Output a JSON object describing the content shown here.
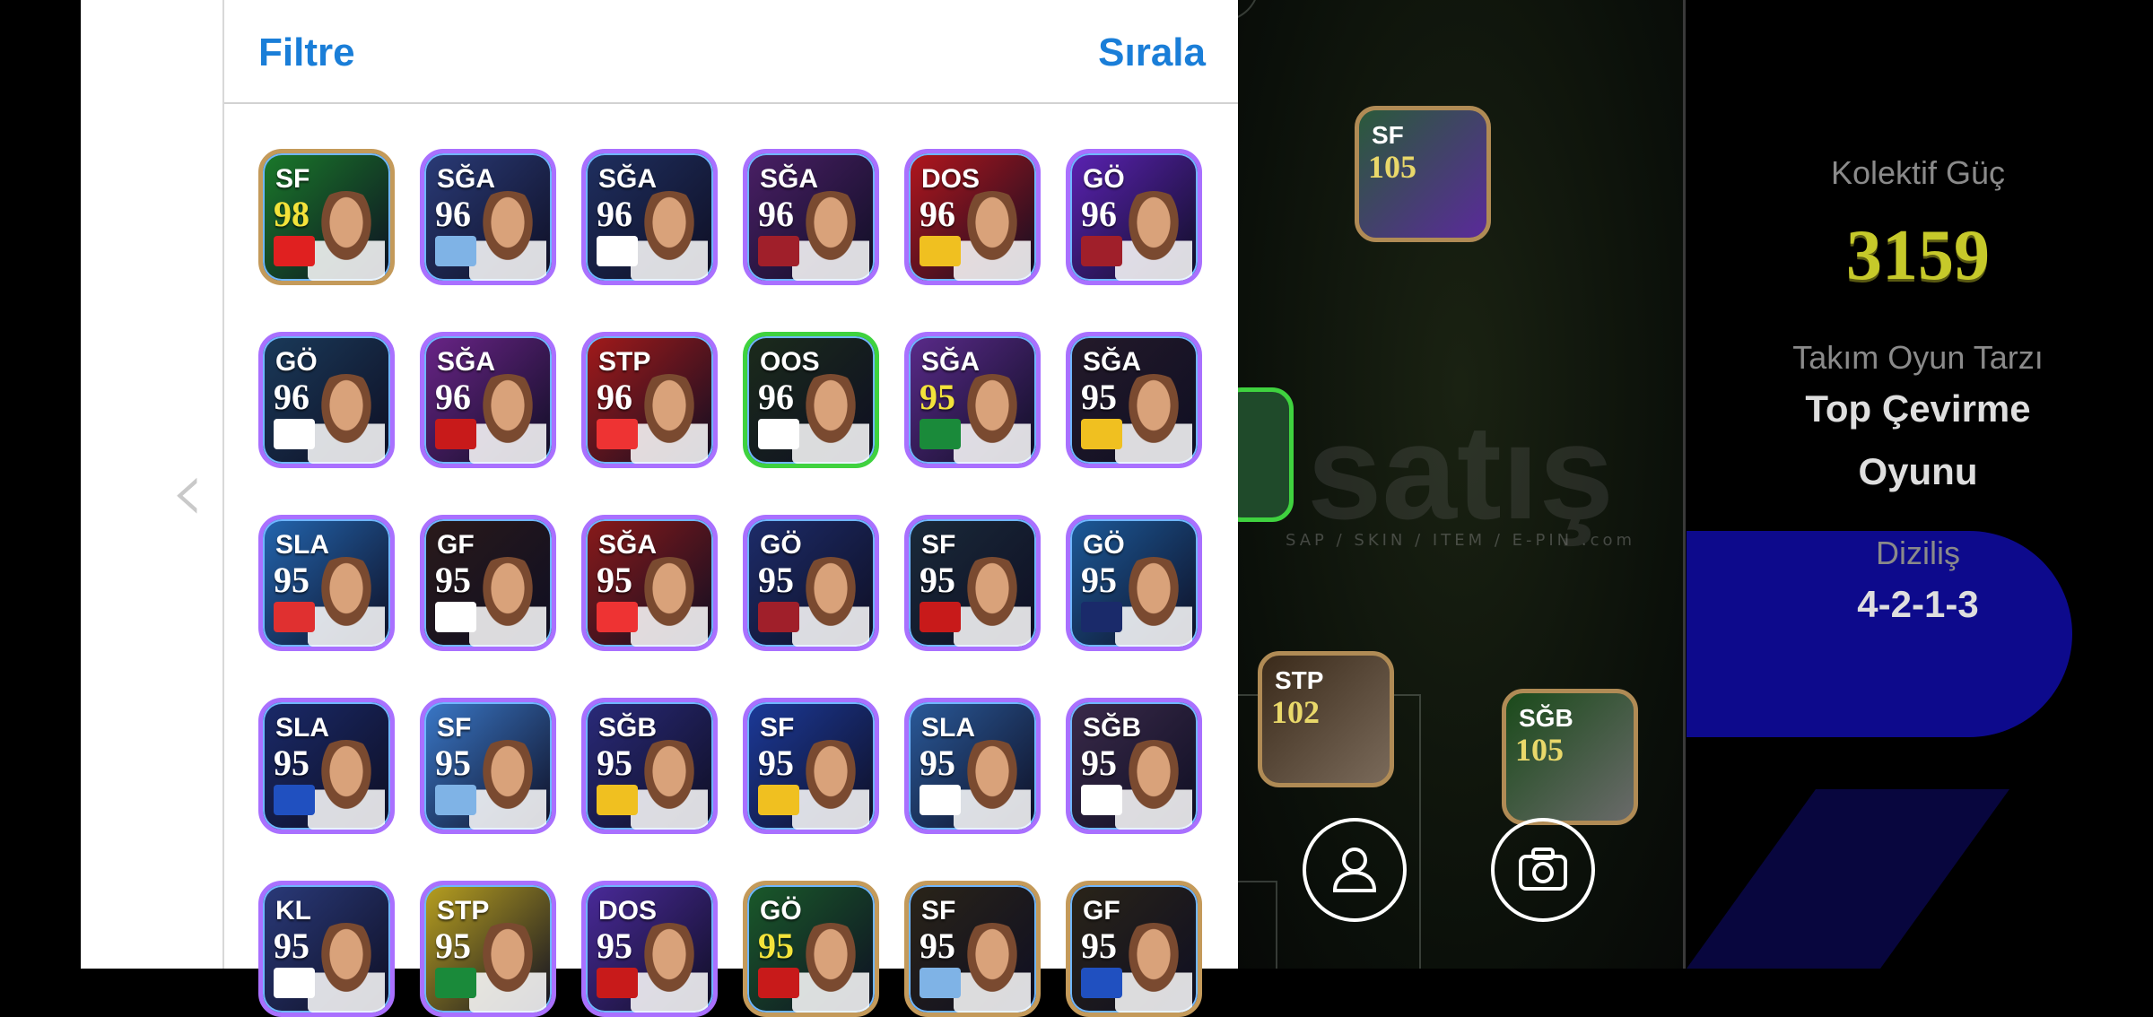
{
  "header": {
    "filter_label": "Filtre",
    "sort_label": "Sırala"
  },
  "players": [
    {
      "position": "SF",
      "rating": "98",
      "rating_color": "#f3e33a",
      "bg": "#1a7a2a",
      "badge": "#e02020",
      "border": "#c49a5a"
    },
    {
      "position": "SĞA",
      "rating": "96",
      "rating_color": "#ffffff",
      "bg": "#2a3b78",
      "badge": "#7fb3e6",
      "border": "#a970ff"
    },
    {
      "position": "SĞA",
      "rating": "96",
      "rating_color": "#ffffff",
      "bg": "#1f2f60",
      "badge": "#ffffff",
      "border": "#a970ff"
    },
    {
      "position": "SĞA",
      "rating": "96",
      "rating_color": "#ffffff",
      "bg": "#4a1f66",
      "badge": "#a01f2a",
      "border": "#a970ff"
    },
    {
      "position": "DOS",
      "rating": "96",
      "rating_color": "#ffffff",
      "bg": "#b3161d",
      "badge": "#f0c020",
      "border": "#a970ff"
    },
    {
      "position": "GÖ",
      "rating": "96",
      "rating_color": "#ffffff",
      "bg": "#5b22b3",
      "badge": "#a01f2a",
      "border": "#a970ff"
    },
    {
      "position": "GÖ",
      "rating": "96",
      "rating_color": "#ffffff",
      "bg": "#1a3a5a",
      "badge": "#ffffff",
      "border": "#a970ff"
    },
    {
      "position": "SĞA",
      "rating": "96",
      "rating_color": "#ffffff",
      "bg": "#6a2488",
      "badge": "#c81a1a",
      "border": "#a970ff"
    },
    {
      "position": "STP",
      "rating": "96",
      "rating_color": "#ffffff",
      "bg": "#a31a1a",
      "badge": "#e33",
      "border": "#a970ff"
    },
    {
      "position": "OOS",
      "rating": "96",
      "rating_color": "#ffffff",
      "bg": "#1b2b1b",
      "badge": "#ffffff",
      "border": "#3fd23f"
    },
    {
      "position": "SĞA",
      "rating": "95",
      "rating_color": "#f3e33a",
      "bg": "#5a2a8a",
      "badge": "#1a8a3a",
      "border": "#a970ff"
    },
    {
      "position": "SĞA",
      "rating": "95",
      "rating_color": "#ffffff",
      "bg": "#241a2a",
      "badge": "#f0c020",
      "border": "#a970ff"
    },
    {
      "position": "SLA",
      "rating": "95",
      "rating_color": "#ffffff",
      "bg": "#2366b0",
      "badge": "#e03030",
      "border": "#a970ff"
    },
    {
      "position": "GF",
      "rating": "95",
      "rating_color": "#ffffff",
      "bg": "#2a1a1a",
      "badge": "#ffffff",
      "border": "#a970ff"
    },
    {
      "position": "SĞA",
      "rating": "95",
      "rating_color": "#ffffff",
      "bg": "#8a1a1a",
      "badge": "#e33",
      "border": "#a970ff"
    },
    {
      "position": "GÖ",
      "rating": "95",
      "rating_color": "#ffffff",
      "bg": "#1d2c6a",
      "badge": "#a01f2a",
      "border": "#a970ff"
    },
    {
      "position": "SF",
      "rating": "95",
      "rating_color": "#ffffff",
      "bg": "#1a2a3a",
      "badge": "#c81a1a",
      "border": "#a970ff"
    },
    {
      "position": "GÖ",
      "rating": "95",
      "rating_color": "#ffffff",
      "bg": "#1c5a9a",
      "badge": "#1a2a6a",
      "border": "#a970ff"
    },
    {
      "position": "SLA",
      "rating": "95",
      "rating_color": "#ffffff",
      "bg": "#1a2a6a",
      "badge": "#2050c0",
      "border": "#a970ff"
    },
    {
      "position": "SF",
      "rating": "95",
      "rating_color": "#ffffff",
      "bg": "#3a78c8",
      "badge": "#7fb3e6",
      "border": "#a970ff"
    },
    {
      "position": "SĞB",
      "rating": "95",
      "rating_color": "#ffffff",
      "bg": "#2a2a7a",
      "badge": "#f0c020",
      "border": "#a970ff"
    },
    {
      "position": "SF",
      "rating": "95",
      "rating_color": "#ffffff",
      "bg": "#1c3a9a",
      "badge": "#f0c020",
      "border": "#a970ff"
    },
    {
      "position": "SLA",
      "rating": "95",
      "rating_color": "#ffffff",
      "bg": "#2a5a9a",
      "badge": "#ffffff",
      "border": "#a970ff"
    },
    {
      "position": "SĞB",
      "rating": "95",
      "rating_color": "#ffffff",
      "bg": "#3a2a4a",
      "badge": "#ffffff",
      "border": "#a970ff"
    },
    {
      "position": "KL",
      "rating": "95",
      "rating_color": "#ffffff",
      "bg": "#2a3a7a",
      "badge": "#ffffff",
      "border": "#a970ff"
    },
    {
      "position": "STP",
      "rating": "95",
      "rating_color": "#ffffff",
      "bg": "#b8a020",
      "badge": "#1a8a3a",
      "border": "#a970ff"
    },
    {
      "position": "DOS",
      "rating": "95",
      "rating_color": "#ffffff",
      "bg": "#4a2a9a",
      "badge": "#c81a1a",
      "border": "#a970ff"
    },
    {
      "position": "GÖ",
      "rating": "95",
      "rating_color": "#f3e33a",
      "bg": "#1a5a2a",
      "badge": "#c81a1a",
      "border": "#c49a5a"
    },
    {
      "position": "SF",
      "rating": "95",
      "rating_color": "#ffffff",
      "bg": "#2a2418",
      "badge": "#7fb3e6",
      "border": "#c49a5a"
    },
    {
      "position": "GF",
      "rating": "95",
      "rating_color": "#ffffff",
      "bg": "#2a2418",
      "badge": "#2050c0",
      "border": "#c49a5a"
    }
  ],
  "pitch": {
    "watermark": "satış",
    "watermark_sub": "SAP / SKIN / ITEM / E-PIN",
    "watermark_com": ".com",
    "cards": [
      {
        "position": "SF",
        "rating": "105"
      },
      {
        "position": "STP",
        "rating": "102"
      },
      {
        "position": "SĞB",
        "rating": "105"
      }
    ]
  },
  "team": {
    "collective_power_label": "Kolektif Güç",
    "collective_power_value": "3159",
    "playstyle_label": "Takım Oyun Tarzı",
    "playstyle_value_line1": "Top Çevirme",
    "playstyle_value_line2": "Oyunu",
    "formation_label": "Diziliş",
    "formation_value": "4-2-1-3"
  }
}
